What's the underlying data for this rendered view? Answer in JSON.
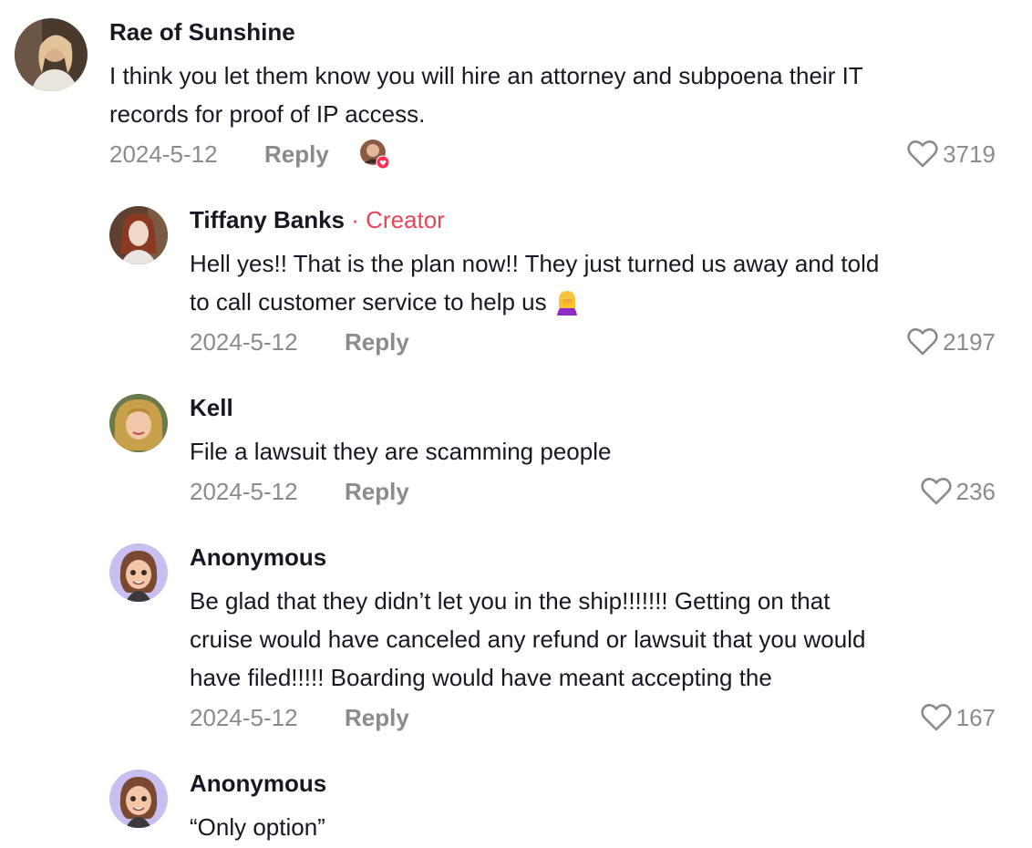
{
  "comments": [
    {
      "username": "Rae of Sunshine",
      "text_lines": [
        "I think you let them know you will hire an attorney and subpoena their IT",
        "records for proof of IP access."
      ],
      "date": "2024-5-12",
      "reply_label": "Reply",
      "likes": "3719",
      "creator_liked": true
    },
    {
      "username": "Tiffany Banks",
      "badge": "· Creator",
      "text_lines": [
        "Hell yes!! That is the plan now!! They just turned us away and told",
        "to call customer service to help us"
      ],
      "date": "2024-5-12",
      "reply_label": "Reply",
      "likes": "2197"
    },
    {
      "username": "Kell",
      "text_lines": [
        "File a lawsuit they are scamming people"
      ],
      "date": "2024-5-12",
      "reply_label": "Reply",
      "likes": "236"
    },
    {
      "username": "Anonymous",
      "text_lines": [
        "Be glad that they didn’t let you in the ship!!!!!!! Getting on that",
        "cruise would have canceled any refund or lawsuit that you would",
        "have filed!!!!! Boarding would have meant accepting the"
      ],
      "date": "2024-5-12",
      "reply_label": "Reply",
      "likes": "167"
    },
    {
      "username": "Anonymous",
      "text_lines": [
        "“Only option”"
      ]
    }
  ],
  "icons": {
    "like": "heart-outline-icon",
    "emoji": "woman-facepalming-emoji",
    "liked_by_creator": "creator-liked-badge-icon"
  },
  "colors": {
    "text": "#161823",
    "secondary": "#8a8b91",
    "creator_accent": "#e8445a"
  }
}
